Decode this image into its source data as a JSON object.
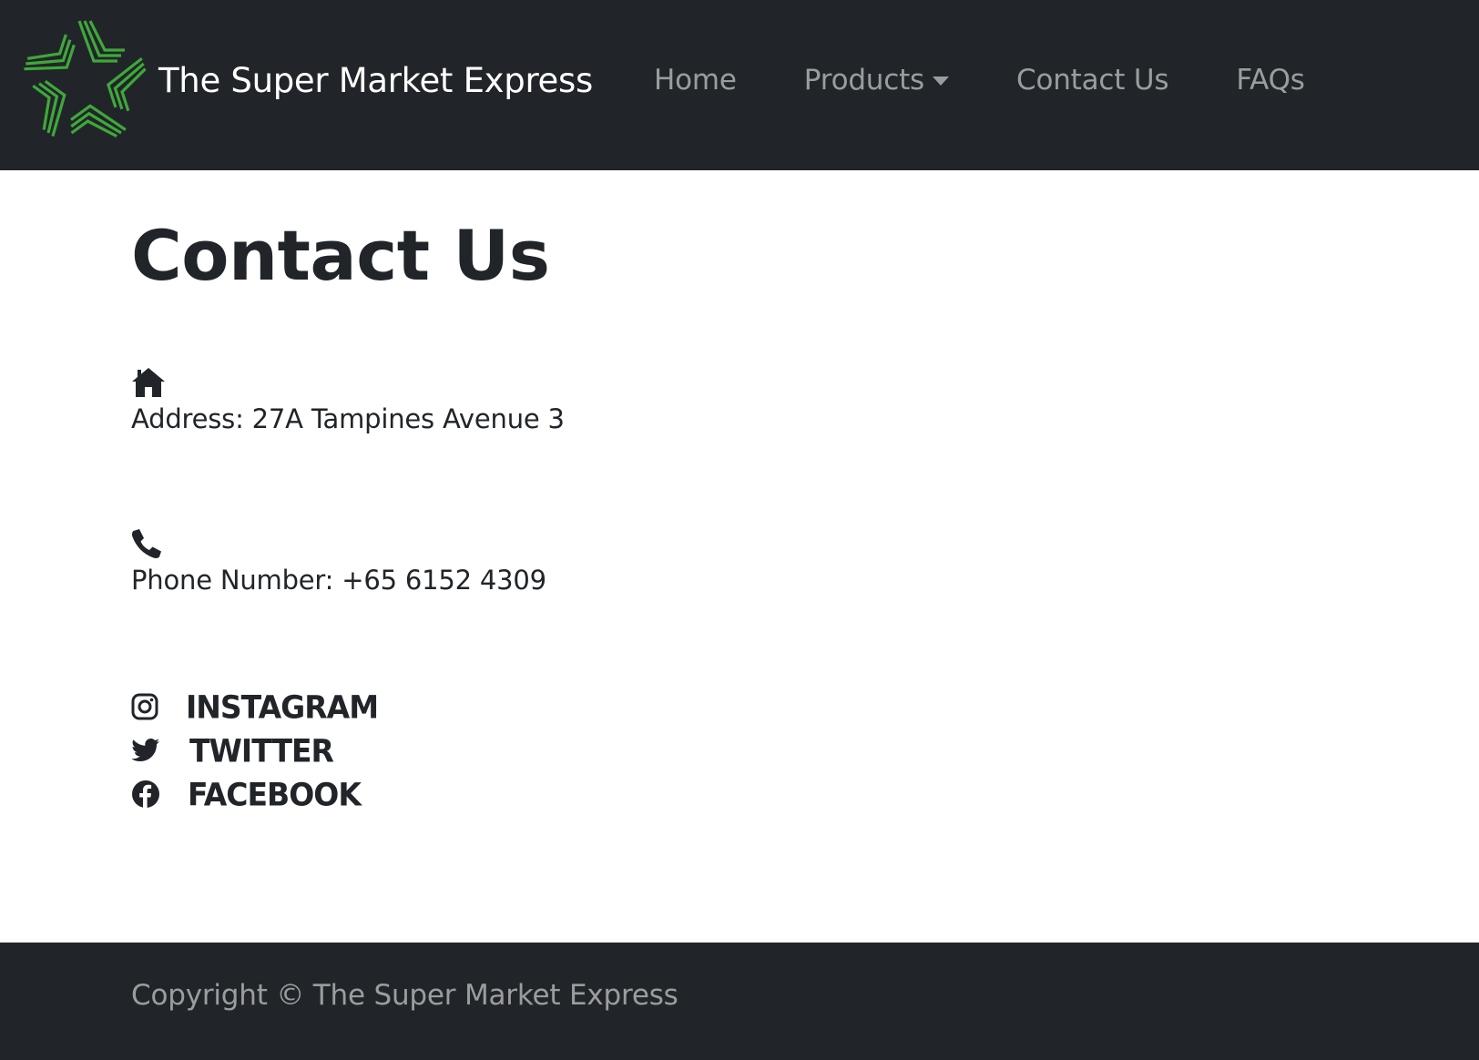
{
  "navbar": {
    "brand_name": "The Super Market Express",
    "logo_icon": "green-star-logo",
    "links": [
      {
        "label": "Home"
      },
      {
        "label": "Products",
        "has_dropdown": true
      },
      {
        "label": "Contact Us"
      },
      {
        "label": "FAQs"
      }
    ]
  },
  "page": {
    "title": "Contact Us"
  },
  "contact": {
    "address": {
      "icon": "home-icon",
      "text": "Address: 27A Tampines Avenue 3"
    },
    "phone": {
      "icon": "phone-icon",
      "text": "Phone Number: +65 6152 4309"
    }
  },
  "social": [
    {
      "icon": "instagram-icon",
      "label": "INSTAGRAM"
    },
    {
      "icon": "twitter-icon",
      "label": "TWITTER"
    },
    {
      "icon": "facebook-icon",
      "label": "FACEBOOK"
    }
  ],
  "footer": {
    "copyright": "Copyright © The Super Market Express"
  },
  "colors": {
    "navbar_bg": "#212529",
    "logo_green": "#3fa83a",
    "text_dark": "#212529",
    "nav_text": "rgba(255,255,255,0.55)"
  }
}
